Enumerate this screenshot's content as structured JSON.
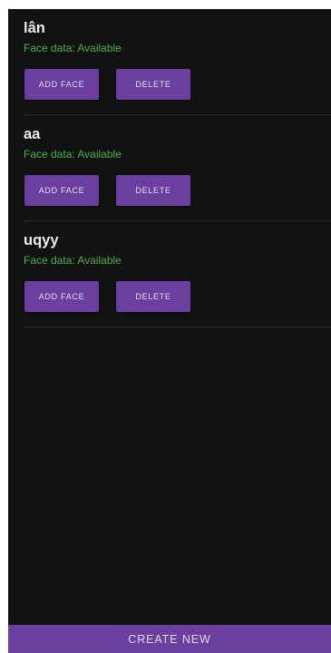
{
  "colors": {
    "background": "#121212",
    "accent": "#6a3fa0",
    "status_green": "#4caf50"
  },
  "faces": [
    {
      "name": "lân",
      "status": "Face data: Available",
      "add_label": "ADD FACE",
      "delete_label": "DELETE"
    },
    {
      "name": "aa",
      "status": "Face data: Available",
      "add_label": "ADD FACE",
      "delete_label": "DELETE"
    },
    {
      "name": "uqyy",
      "status": "Face data: Available",
      "add_label": "ADD FACE",
      "delete_label": "DELETE"
    }
  ],
  "create_button": {
    "label": "CREATE NEW"
  }
}
